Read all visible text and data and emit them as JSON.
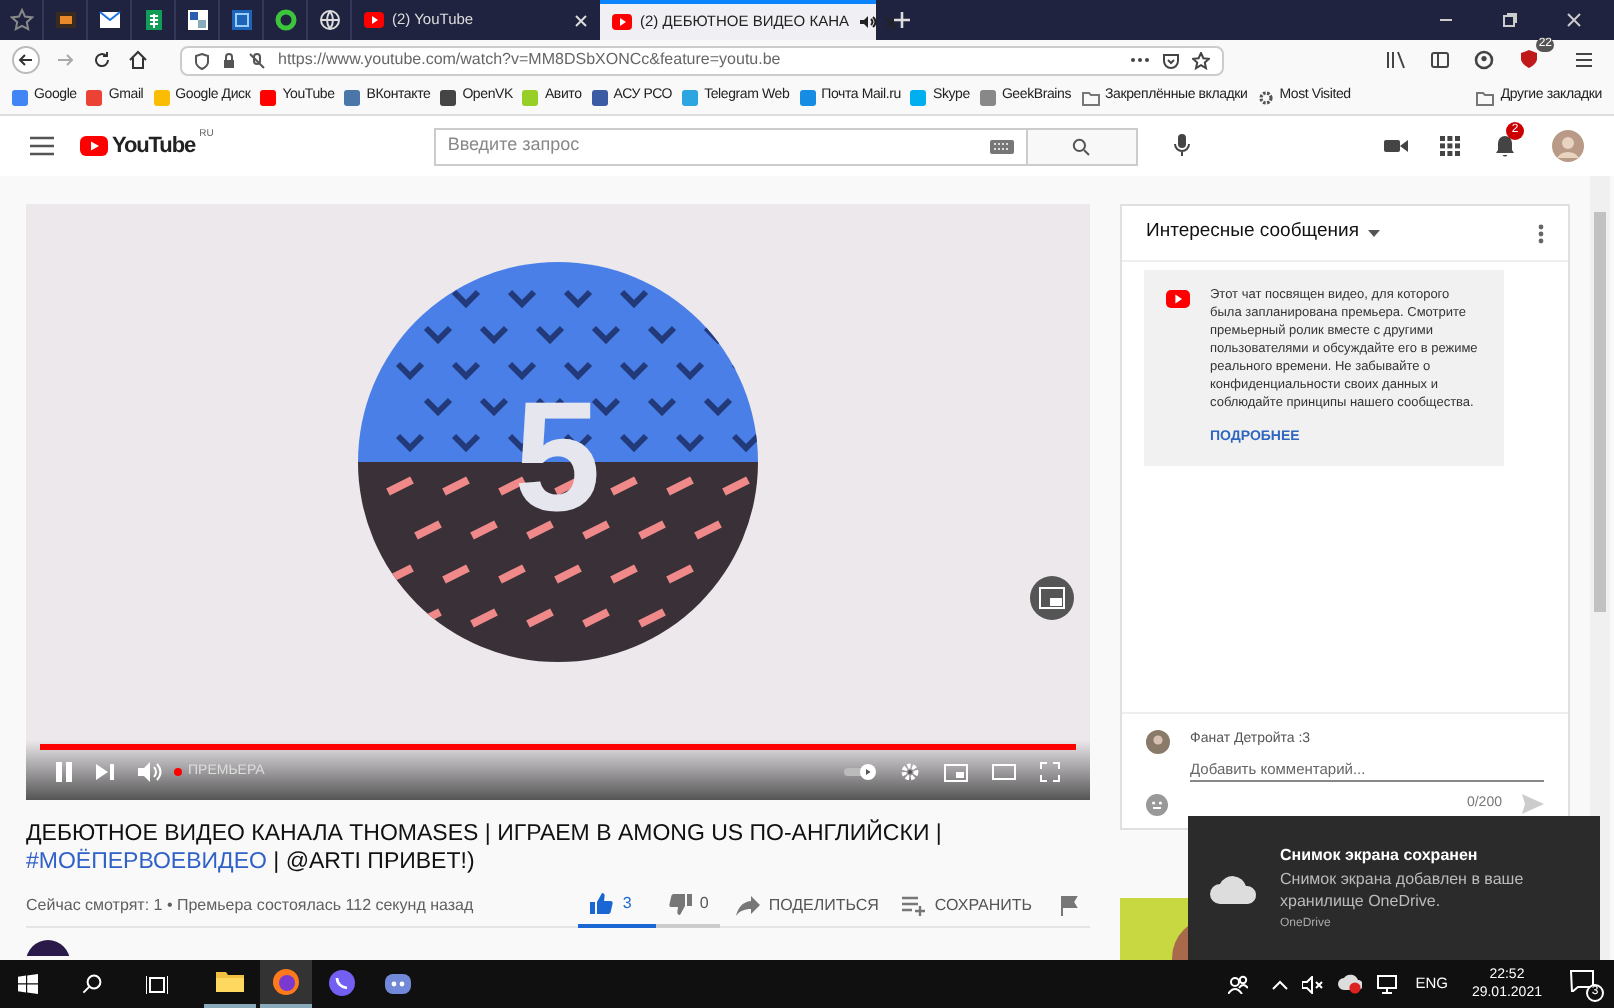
{
  "browser": {
    "tabs": [
      {
        "title": "(2) YouTube",
        "selected": false,
        "audio": false
      },
      {
        "title": "(2) ДЕБЮТНОЕ ВИДЕО КАНА",
        "selected": true,
        "audio": true
      }
    ],
    "url": "https://www.youtube.com/watch?v=MM8DSbXONCc&feature=youtu.be",
    "extension_badge": "22",
    "bookmarks": [
      {
        "label": "Google",
        "kind": "site",
        "color": "#4285f4"
      },
      {
        "label": "Gmail",
        "kind": "site",
        "color": "#ea4335"
      },
      {
        "label": "Google Диск",
        "kind": "site",
        "color": "#fbbc04"
      },
      {
        "label": "YouTube",
        "kind": "site",
        "color": "#ff0000"
      },
      {
        "label": "ВКонтакте",
        "kind": "site",
        "color": "#4a76a8"
      },
      {
        "label": "OpenVK",
        "kind": "site",
        "color": "#444444"
      },
      {
        "label": "Авито",
        "kind": "site",
        "color": "#97cf26"
      },
      {
        "label": "АСУ РСО",
        "kind": "site",
        "color": "#3b5ba5"
      },
      {
        "label": "Telegram Web",
        "kind": "site",
        "color": "#2ca5e0"
      },
      {
        "label": "Почта Mail.ru",
        "kind": "site",
        "color": "#168de2"
      },
      {
        "label": "Skype",
        "kind": "site",
        "color": "#00aff0"
      },
      {
        "label": "GeekBrains",
        "kind": "site",
        "color": "#888888"
      },
      {
        "label": "Закреплённые вкладки",
        "kind": "folder",
        "color": "#777777"
      },
      {
        "label": "Most Visited",
        "kind": "gear",
        "color": "#555555"
      }
    ],
    "other_bookmarks": "Другие закладки"
  },
  "youtube": {
    "logo": "YouTube",
    "region": "RU",
    "search": {
      "placeholder": "Введите запрос"
    },
    "notification_count": "2",
    "player": {
      "level": 1,
      "live_label": "ПРЕМЬЕРА",
      "numeral": "5"
    },
    "title": [
      {
        "kind": "plain",
        "text": "ДЕБЮТНОЕ ВИДЕО КАНАЛА THOMASES | ИГРАЕМ В AMONG US ПО-АНГЛИЙСКИ | "
      },
      {
        "kind": "link",
        "text": "#МОЁПЕРВОЕВИДЕО"
      },
      {
        "kind": "plain",
        "text": " | @ARTI ПРИВЕТ!)"
      }
    ],
    "meta": "Сейчас смотрят: 1 • Премьера состоялась 112 секунд назад",
    "actions": [
      {
        "kind": "like",
        "label": "3",
        "selected": true
      },
      {
        "kind": "dislike",
        "label": "0",
        "selected": false
      },
      {
        "kind": "share",
        "label": "ПОДЕЛИТЬСЯ"
      },
      {
        "kind": "save",
        "label": "СОХРАНИТЬ"
      },
      {
        "kind": "flag"
      }
    ],
    "chat": {
      "title": "Интересные сообщения",
      "notice": "Этот чат посвящен видео, для которого была запланирована премьера. Смотрите премьерный ролик вместе с другими пользователями и обсуждайте его в режиме реального времени. Не забывайте о конфиденциальности своих данных и соблюдайте принципы нашего сообщества.",
      "more": "ПОДРОБНЕЕ",
      "user": "Фанат Детройта :3",
      "placeholder": "Добавить комментарий...",
      "counter": "0/200"
    }
  },
  "toast": {
    "title": "Снимок экрана сохранен",
    "body": "Снимок экрана добавлен в ваше хранилище OneDrive.",
    "source": "OneDrive"
  },
  "taskbar": {
    "language": "ENG",
    "time": "22:52",
    "date": "29.01.2021",
    "notifications": "3"
  }
}
